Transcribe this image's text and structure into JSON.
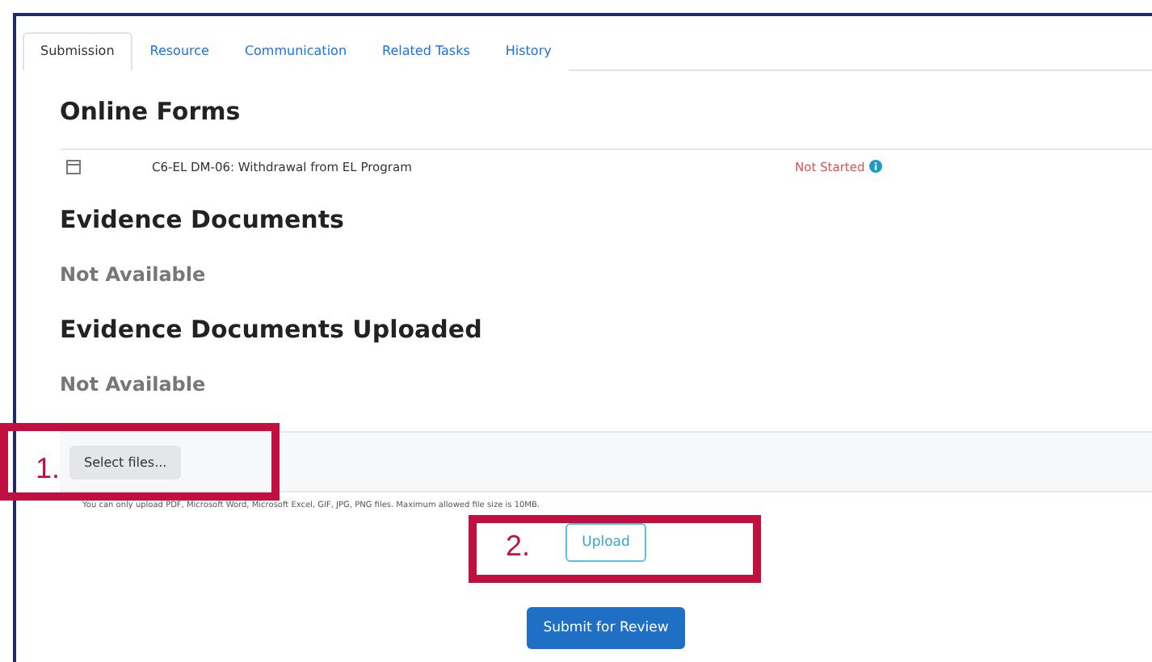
{
  "tabs": [
    {
      "label": "Submission",
      "selected": true
    },
    {
      "label": "Resource",
      "selected": false
    },
    {
      "label": "Communication",
      "selected": false
    },
    {
      "label": "Related Tasks",
      "selected": false
    },
    {
      "label": "History",
      "selected": false
    }
  ],
  "online_forms": {
    "heading": "Online Forms",
    "rows": [
      {
        "name": "C6-EL DM-06: Withdrawal from EL Program",
        "status": "Not Started"
      }
    ]
  },
  "evidence_documents": {
    "heading": "Evidence Documents",
    "empty_text": "Not Available"
  },
  "evidence_uploaded": {
    "heading": "Evidence Documents Uploaded",
    "empty_text": "Not Available"
  },
  "upload": {
    "select_button": "Select files...",
    "hint": "You can only upload PDF, Microsoft Word, Microsoft Excel, GIF, JPG, PNG files. Maximum allowed file size is 10MB.",
    "upload_button": "Upload"
  },
  "submit_button": "Submit for Review",
  "annotations": [
    {
      "label": "1."
    },
    {
      "label": "2."
    }
  ]
}
